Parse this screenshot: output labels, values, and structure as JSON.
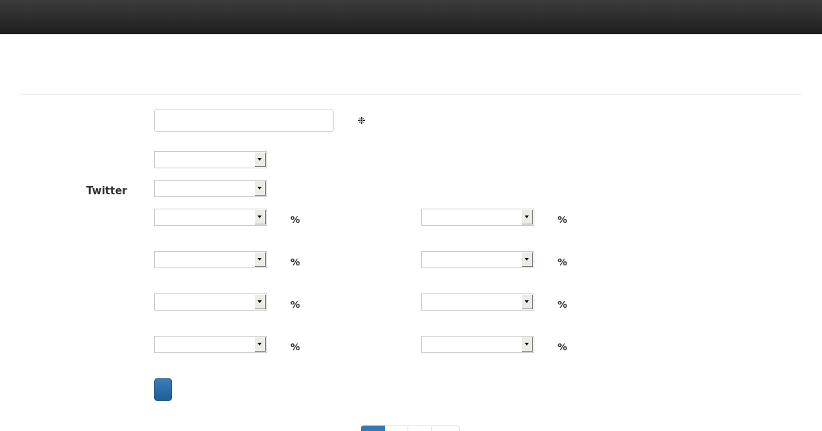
{
  "form": {
    "icon_glyph": "❉",
    "label": "Twitter",
    "pair_rows": [
      {
        "unit_left": "%",
        "unit_right": "%"
      },
      {
        "unit_left": "%",
        "unit_right": "%"
      },
      {
        "unit_left": "%",
        "unit_right": "%"
      },
      {
        "unit_left": "%",
        "unit_right": "%"
      }
    ]
  },
  "pagination": [
    {
      "selected": true
    },
    {
      "selected": false
    },
    {
      "selected": false
    },
    {
      "selected": false
    }
  ]
}
